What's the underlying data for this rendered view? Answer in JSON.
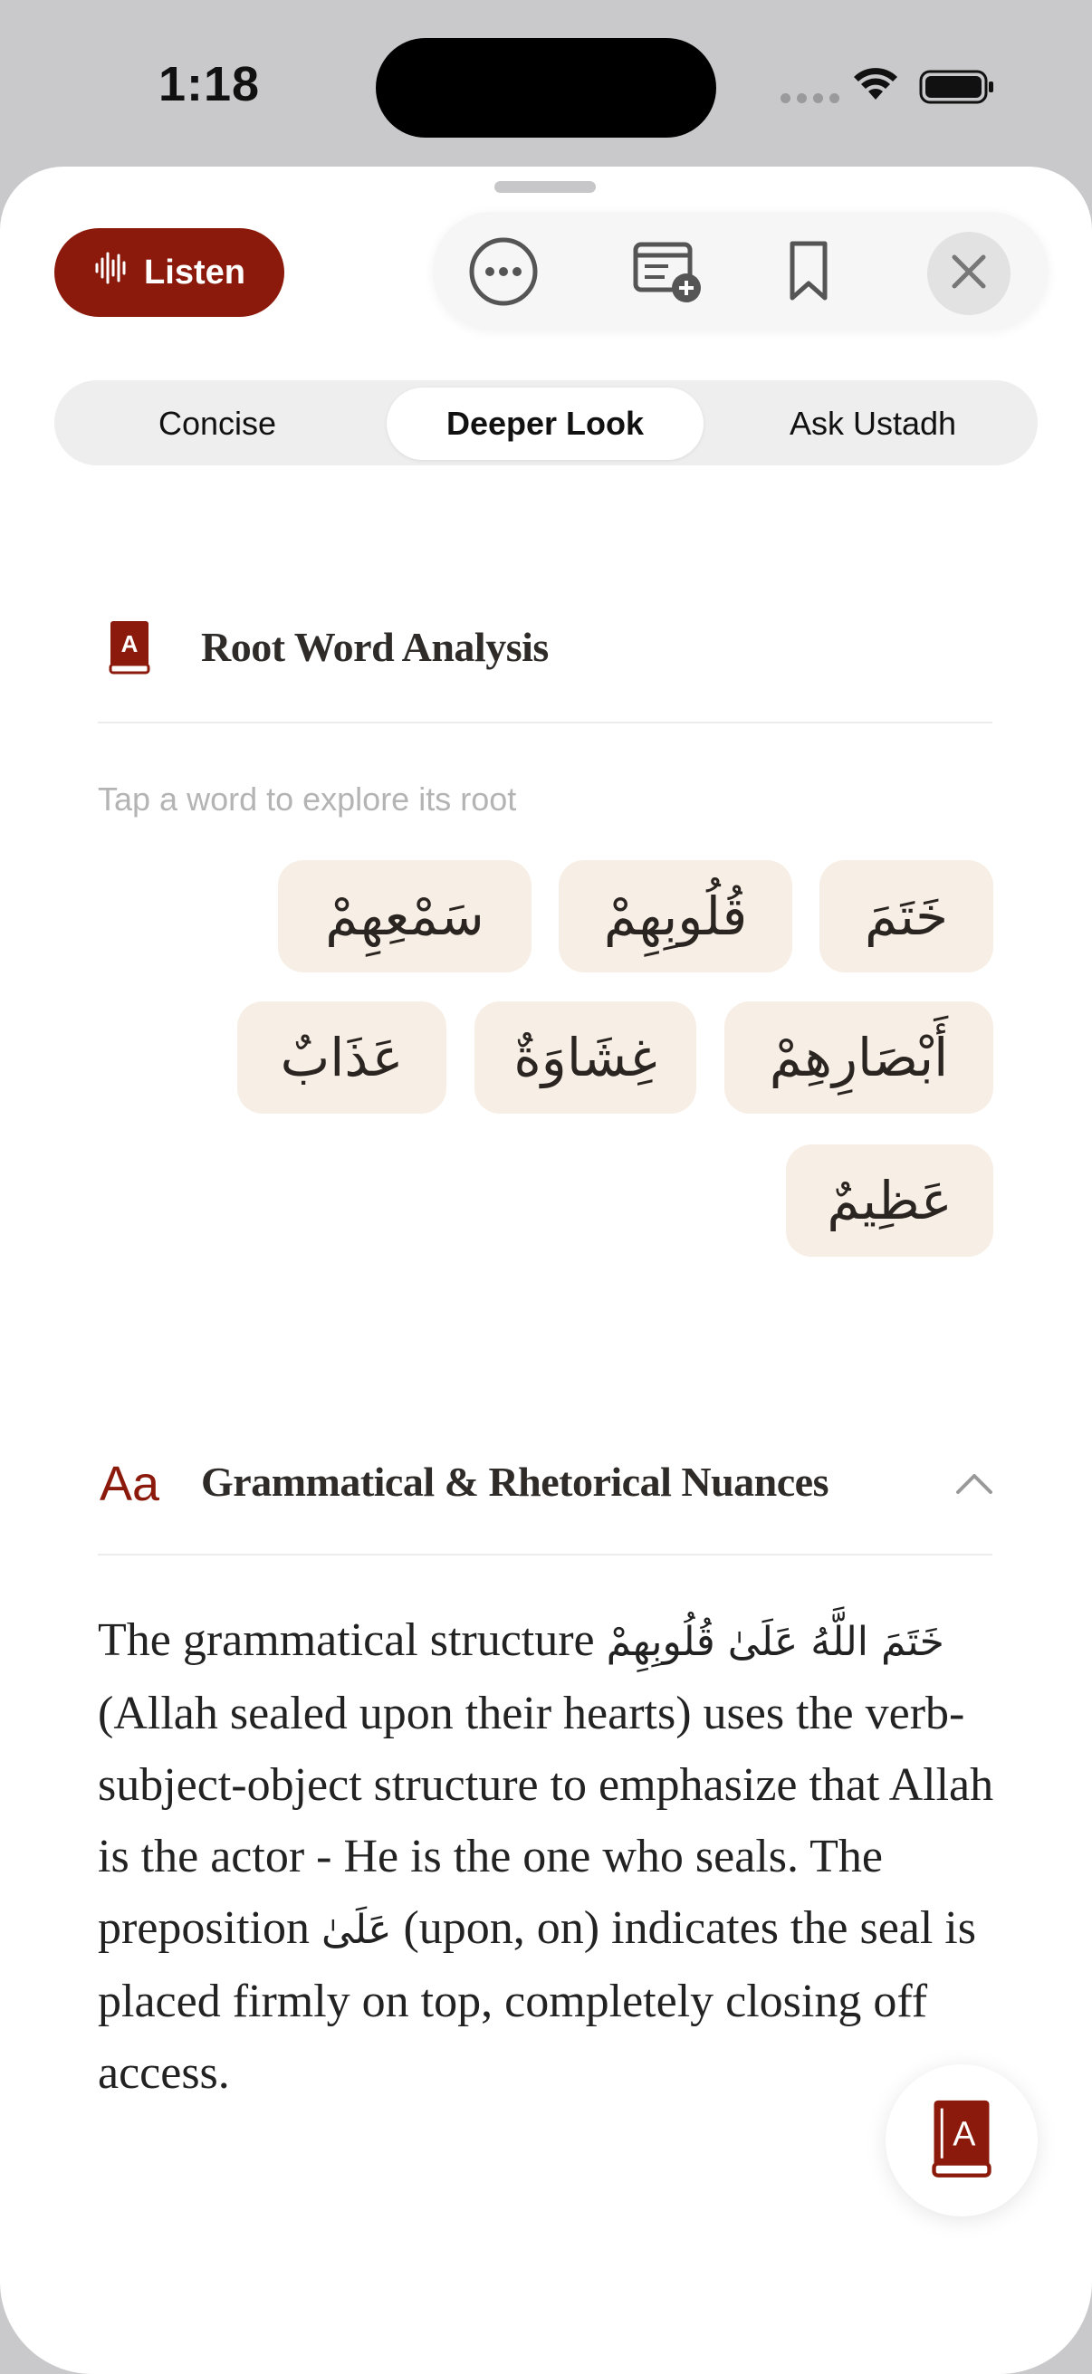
{
  "status_bar": {
    "time": "1:18",
    "icons": [
      "cellular-dots-icon",
      "wifi-icon",
      "battery-icon"
    ]
  },
  "toolbar": {
    "listen_label": "Listen",
    "icons": [
      "waveform-icon",
      "more-icon",
      "add-note-icon",
      "bookmark-icon",
      "close-icon"
    ]
  },
  "tabs": {
    "items": [
      "Concise",
      "Deeper Look",
      "Ask Ustadh"
    ],
    "selected": "Deeper Look"
  },
  "root_analysis": {
    "title": "Root Word Analysis",
    "hint": "Tap a word to explore its root",
    "words": [
      "خَتَمَ",
      "قُلُوبِهِمْ",
      "سَمْعِهِمْ",
      "أَبْصَارِهِمْ",
      "غِشَاوَةٌ",
      "عَذَابٌ",
      "عَظِيمٌ"
    ]
  },
  "nuances": {
    "icon_text": "Aa",
    "title": "Grammatical & Rhetorical Nuances",
    "expanded": true,
    "paragraph": {
      "part1": "The grammatical structure ",
      "arabic1": "خَتَمَ اللَّهُ عَلَىٰ قُلُوبِهِمْ",
      "part2": " (Allah sealed upon their hearts) uses the verb-subject-object structure to emphasize that Allah is the actor - He is the one who seals. The preposition ",
      "arabic2": "عَلَىٰ",
      "part3": " (upon, on) indicates the seal is placed firmly on top, completely closing off access."
    }
  },
  "colors": {
    "accent": "#8c1a0c",
    "chip_bg": "#f7efe6",
    "segment_bg": "#eeeeee"
  }
}
